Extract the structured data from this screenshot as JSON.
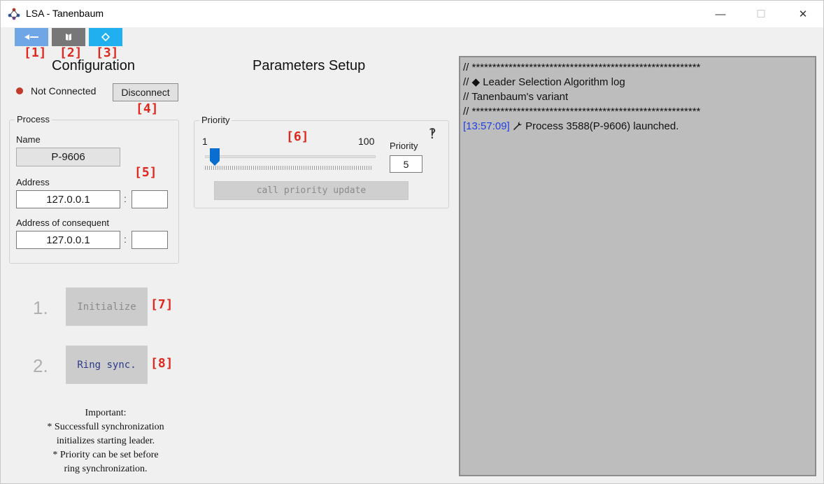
{
  "window": {
    "title": "LSA - Tanenbaum",
    "minimize_icon": "minimize-icon",
    "maximize_icon": "maximize-icon",
    "close_icon": "close-icon"
  },
  "toolbar": {
    "buttons": [
      {
        "icon": "arrow-left-icon",
        "color": "#6fa6e6"
      },
      {
        "icon": "book-icon",
        "color": "#777777"
      },
      {
        "icon": "diamond-icon",
        "color": "#20b0f0"
      }
    ]
  },
  "markers": [
    "[1]",
    "[2]",
    "[3]",
    "[4]",
    "[5]",
    "[6]",
    "[7]",
    "[8]"
  ],
  "configuration": {
    "title": "Configuration",
    "status": {
      "text": "Not Connected",
      "color": "#c0392b"
    },
    "disconnect_label": "Disconnect",
    "process_group": {
      "label": "Process",
      "name_label": "Name",
      "name_value": "P-9606",
      "address_label": "Address",
      "address_value": "127.0.0.1",
      "address_port": "",
      "consequent_label": "Address of consequent",
      "consequent_value": "127.0.0.1",
      "consequent_port": "",
      "separator": ":"
    }
  },
  "parameters": {
    "title": "Parameters Setup",
    "priority_group": {
      "label": "Priority",
      "min": "1",
      "max": "100",
      "value_label": "Priority",
      "value": "5",
      "update_button": "call priority update"
    }
  },
  "steps": [
    {
      "number": "1.",
      "label": "Initialize"
    },
    {
      "number": "2.",
      "label": "Ring sync."
    }
  ],
  "note": {
    "lines": [
      "Important:",
      "* Successfull synchronization",
      "initializes starting leader.",
      "* Priority can be set before",
      "ring synchronization."
    ]
  },
  "log": {
    "lines": [
      "// ********************************************************",
      "// ◆ Leader Selection Algorithm log",
      "// Tanenbaum's variant",
      "// ********************************************************"
    ],
    "entry": {
      "time": "[13:57:09]",
      "icon": "wrench-icon",
      "text": "Process 3588(P-9606) launched."
    }
  }
}
